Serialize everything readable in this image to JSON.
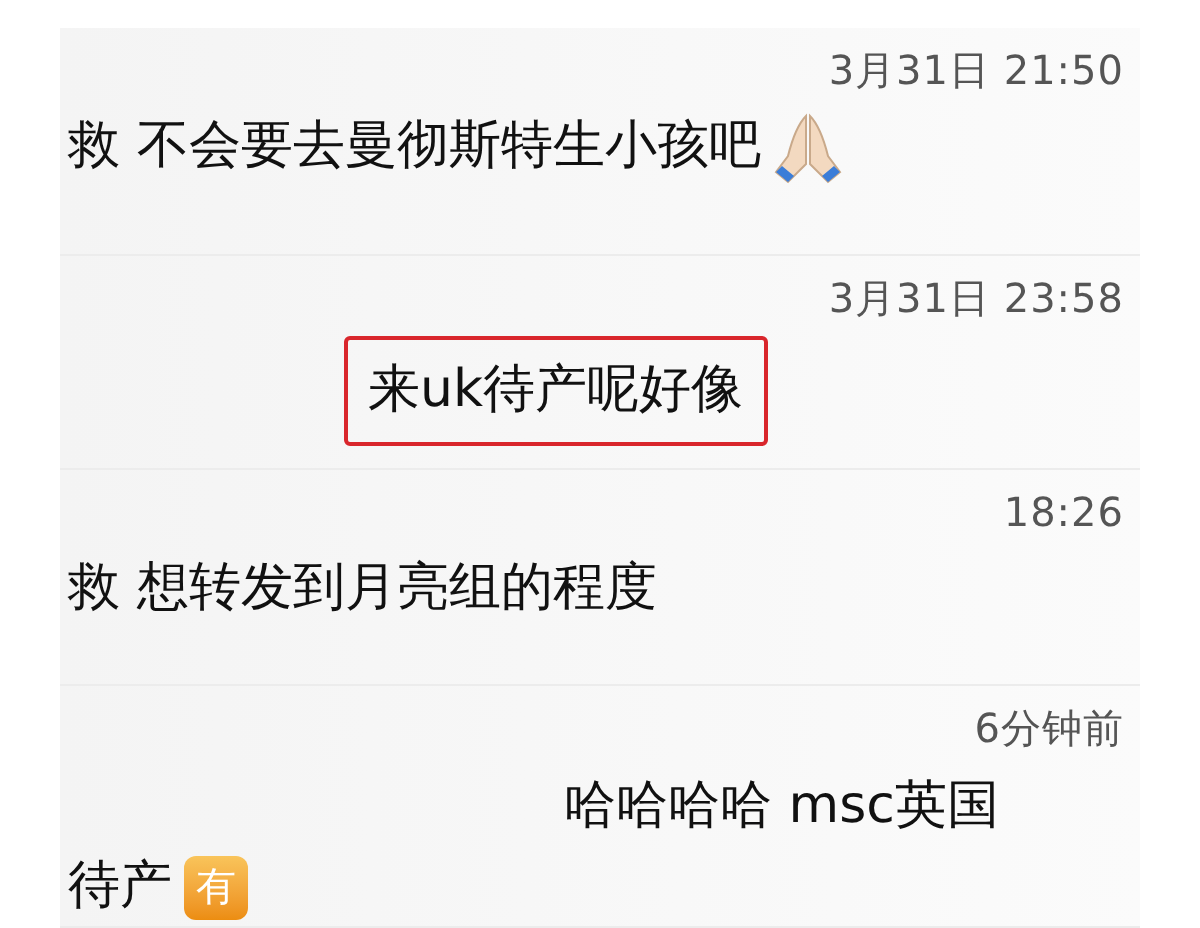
{
  "messages": [
    {
      "time": "3月31日 21:50",
      "text": "救 不会要去曼彻斯特生小孩吧",
      "highlighted": false,
      "emoji": true
    },
    {
      "time": "3月31日 23:58",
      "text": "来uk待产呢好像",
      "highlighted": true
    },
    {
      "time": "18:26",
      "text": "救 想转发到月亮组的程度",
      "highlighted": false
    },
    {
      "time": "6分钟前",
      "text": "哈哈哈哈 msc英国待产",
      "highlighted": false,
      "badge": "有"
    }
  ]
}
